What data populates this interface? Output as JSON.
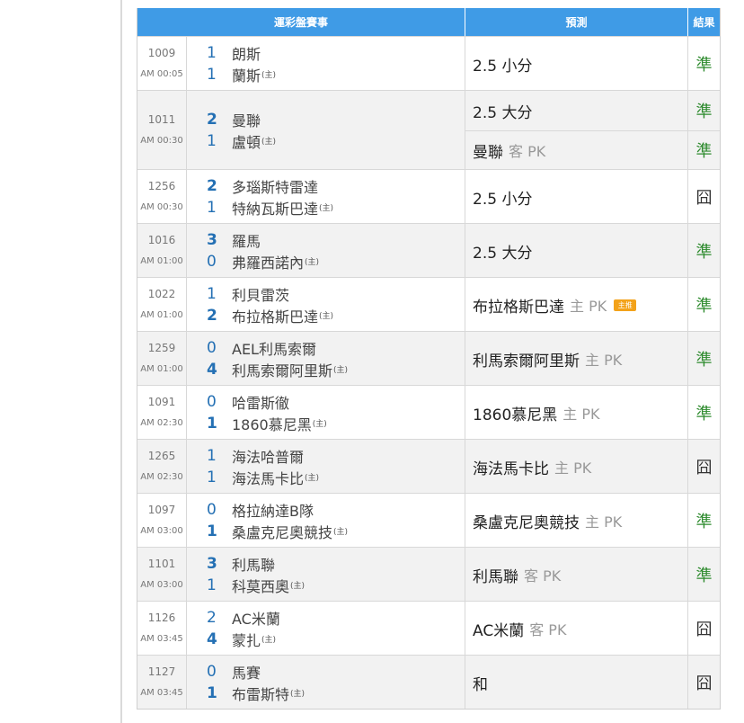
{
  "header": {
    "match": "運彩盤賽事",
    "prediction": "預測",
    "result": "結果"
  },
  "rows": [
    {
      "id": "1009",
      "time": "AM 00:05",
      "away": {
        "score": "1",
        "name": "朗斯"
      },
      "home": {
        "score": "1",
        "name": "蘭斯"
      },
      "home_tag": "(主)",
      "winner": "",
      "preds": [
        {
          "main": "2.5 小分",
          "side": "",
          "hot": ""
        }
      ],
      "results": [
        "準"
      ]
    },
    {
      "id": "1011",
      "time": "AM 00:30",
      "away": {
        "score": "2",
        "name": "曼聯"
      },
      "home": {
        "score": "1",
        "name": "盧頓"
      },
      "home_tag": "(主)",
      "winner": "away",
      "preds": [
        {
          "main": "2.5 大分",
          "side": "",
          "hot": ""
        },
        {
          "main": "曼聯",
          "side": "客 PK",
          "hot": ""
        }
      ],
      "results": [
        "準",
        "準"
      ]
    },
    {
      "id": "1256",
      "time": "AM 00:30",
      "away": {
        "score": "2",
        "name": "多瑙斯特雷達"
      },
      "home": {
        "score": "1",
        "name": "特納瓦斯巴達"
      },
      "home_tag": "(主)",
      "winner": "away",
      "preds": [
        {
          "main": "2.5 小分",
          "side": "",
          "hot": ""
        }
      ],
      "results": [
        "囧"
      ]
    },
    {
      "id": "1016",
      "time": "AM 01:00",
      "away": {
        "score": "3",
        "name": "羅馬"
      },
      "home": {
        "score": "0",
        "name": "弗羅西諾內"
      },
      "home_tag": "(主)",
      "winner": "away",
      "preds": [
        {
          "main": "2.5 大分",
          "side": "",
          "hot": ""
        }
      ],
      "results": [
        "準"
      ]
    },
    {
      "id": "1022",
      "time": "AM 01:00",
      "away": {
        "score": "1",
        "name": "利貝雷茨"
      },
      "home": {
        "score": "2",
        "name": "布拉格斯巴達"
      },
      "home_tag": "(主)",
      "winner": "home",
      "preds": [
        {
          "main": "布拉格斯巴達",
          "side": "主 PK",
          "hot": "主推"
        }
      ],
      "results": [
        "準"
      ]
    },
    {
      "id": "1259",
      "time": "AM 01:00",
      "away": {
        "score": "0",
        "name": "AEL利馬索爾"
      },
      "home": {
        "score": "4",
        "name": "利馬索爾阿里斯"
      },
      "home_tag": "(主)",
      "winner": "home",
      "preds": [
        {
          "main": "利馬索爾阿里斯",
          "side": "主 PK",
          "hot": ""
        }
      ],
      "results": [
        "準"
      ]
    },
    {
      "id": "1091",
      "time": "AM 02:30",
      "away": {
        "score": "0",
        "name": "哈雷斯徹"
      },
      "home": {
        "score": "1",
        "name": "1860慕尼黑"
      },
      "home_tag": "(主)",
      "winner": "home",
      "preds": [
        {
          "main": "1860慕尼黑",
          "side": "主 PK",
          "hot": ""
        }
      ],
      "results": [
        "準"
      ]
    },
    {
      "id": "1265",
      "time": "AM 02:30",
      "away": {
        "score": "1",
        "name": "海法哈普爾"
      },
      "home": {
        "score": "1",
        "name": "海法馬卡比"
      },
      "home_tag": "(主)",
      "winner": "",
      "preds": [
        {
          "main": "海法馬卡比",
          "side": "主 PK",
          "hot": ""
        }
      ],
      "results": [
        "囧"
      ]
    },
    {
      "id": "1097",
      "time": "AM 03:00",
      "away": {
        "score": "0",
        "name": "格拉納達B隊"
      },
      "home": {
        "score": "1",
        "name": "桑盧克尼奧競技"
      },
      "home_tag": "(主)",
      "winner": "home",
      "preds": [
        {
          "main": "桑盧克尼奧競技",
          "side": "主 PK",
          "hot": ""
        }
      ],
      "results": [
        "準"
      ]
    },
    {
      "id": "1101",
      "time": "AM 03:00",
      "away": {
        "score": "3",
        "name": "利馬聯"
      },
      "home": {
        "score": "1",
        "name": "科莫西奧"
      },
      "home_tag": "(主)",
      "winner": "away",
      "preds": [
        {
          "main": "利馬聯",
          "side": "客 PK",
          "hot": ""
        }
      ],
      "results": [
        "準"
      ]
    },
    {
      "id": "1126",
      "time": "AM 03:45",
      "away": {
        "score": "2",
        "name": "AC米蘭"
      },
      "home": {
        "score": "4",
        "name": "蒙扎"
      },
      "home_tag": "(主)",
      "winner": "home",
      "preds": [
        {
          "main": "AC米蘭",
          "side": "客 PK",
          "hot": ""
        }
      ],
      "results": [
        "囧"
      ]
    },
    {
      "id": "1127",
      "time": "AM 03:45",
      "away": {
        "score": "0",
        "name": "馬賽"
      },
      "home": {
        "score": "1",
        "name": "布雷斯特"
      },
      "home_tag": "(主)",
      "winner": "home",
      "preds": [
        {
          "main": "和",
          "side": "",
          "hot": ""
        }
      ],
      "results": [
        "囧"
      ]
    }
  ],
  "colors": {
    "header_bg": "#3f9be6",
    "score": "#2470b4",
    "hit": "#2e8b2e",
    "miss": "#333333",
    "hot_badge": "#f3a21a"
  }
}
